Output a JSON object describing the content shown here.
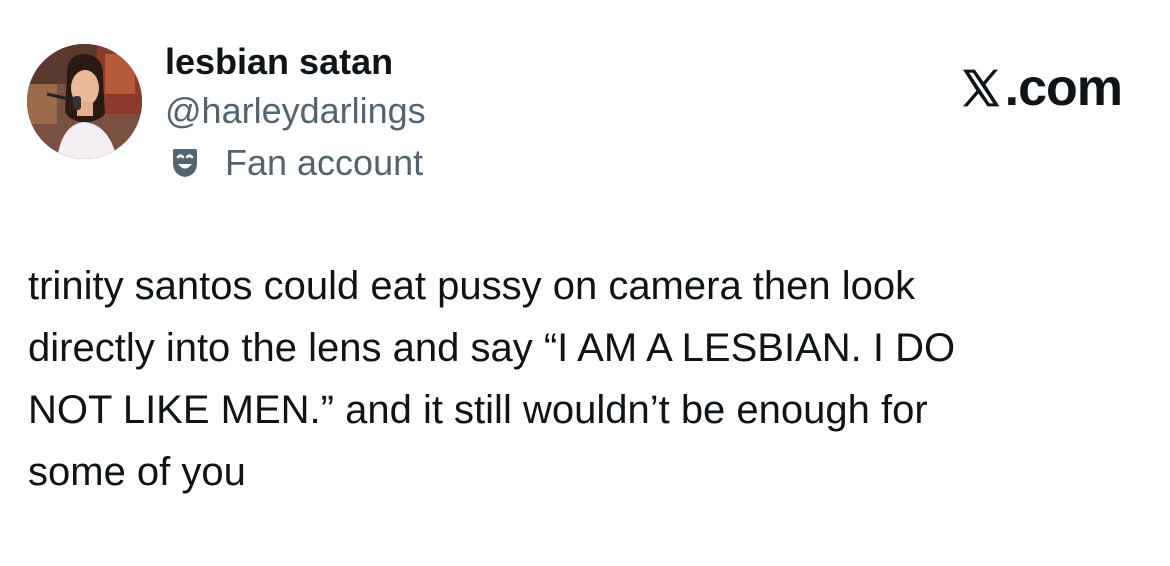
{
  "header": {
    "display_name": "lesbian satan",
    "handle": "@harleydarlings",
    "label": "Fan account",
    "label_icon": "theater-masks-icon",
    "avatar": "profile-avatar-photo"
  },
  "brand": {
    "site_text": ".com",
    "logo_icon": "x-logo-icon"
  },
  "tweet": {
    "lines": [
      "trinity santos could eat pussy on camera then look",
      "directly into the lens and say “I AM A LESBIAN. I DO",
      "NOT LIKE MEN.” and it still wouldn’t be enough for",
      "some of you"
    ]
  },
  "colors": {
    "text_primary": "#0f1419",
    "text_secondary": "#536471",
    "background": "#ffffff"
  }
}
